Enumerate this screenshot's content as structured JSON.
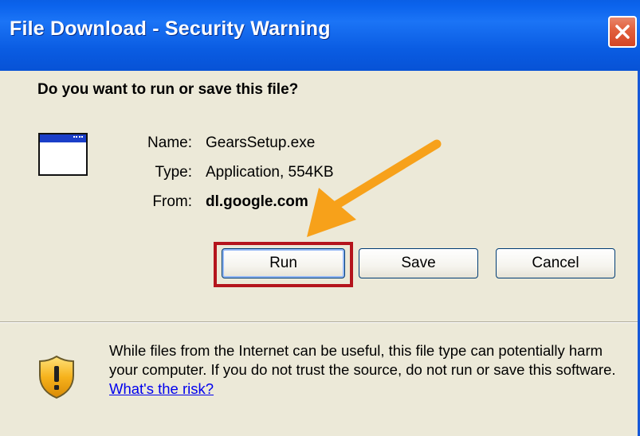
{
  "window": {
    "title": "File Download - Security Warning"
  },
  "dialog": {
    "heading": "Do you want to run or save this file?",
    "file": {
      "name_label": "Name:",
      "name_value": "GearsSetup.exe",
      "type_label": "Type:",
      "type_value": "Application, 554KB",
      "from_label": "From:",
      "from_value": "dl.google.com"
    },
    "buttons": {
      "run": "Run",
      "save": "Save",
      "cancel": "Cancel"
    },
    "warning": {
      "text": "While files from the Internet can be useful, this file type can potentially harm your computer. If you do not trust the source, do not run or save this software.",
      "link": "What's the risk?"
    }
  },
  "icons": [
    "close-icon",
    "application-file-icon",
    "security-shield-icon",
    "annotation-arrow"
  ],
  "colors": {
    "titlebar": "#0a5ce2",
    "dialog_bg": "#ece9d8",
    "highlight_border": "#b4141c",
    "arrow": "#f7a11a",
    "link": "#0000ee"
  }
}
